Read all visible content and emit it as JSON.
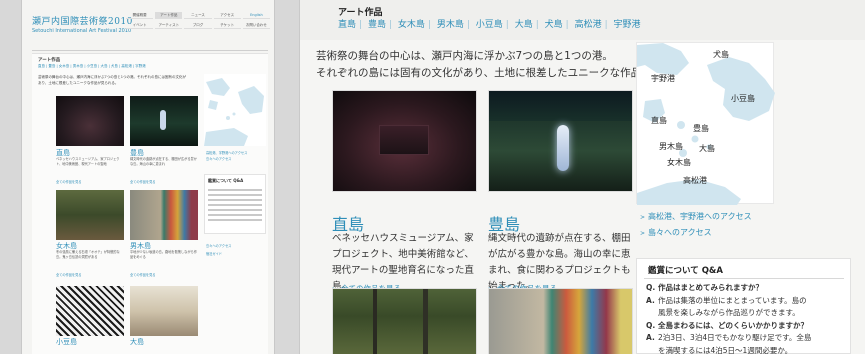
{
  "colors": {
    "accent": "#2e8eb8",
    "page_bg": "#d8d8d8",
    "panel_bg": "#f5f5f3",
    "map_sea": "#ffffff",
    "map_land": "#d0e5ef"
  },
  "thumbnail": {
    "logo_jp": "瀬戸内国際芸術祭2010",
    "logo_en": "Setouchi International Art Festival 2010",
    "nav": [
      {
        "label": "開催概要",
        "state": "normal"
      },
      {
        "label": "アート作品",
        "state": "active"
      },
      {
        "label": "ニュース",
        "state": "normal"
      },
      {
        "label": "アクセス",
        "state": "normal"
      },
      {
        "label": "English",
        "state": "link"
      },
      {
        "label": "イベント",
        "state": "normal"
      },
      {
        "label": "アーティスト",
        "state": "normal"
      },
      {
        "label": "ブログ",
        "state": "normal"
      },
      {
        "label": "チケット",
        "state": "normal"
      },
      {
        "label": "お問い合わせ",
        "state": "normal"
      }
    ],
    "section_title": "アート作品",
    "islands": "直島 | 豊島 | 女木島 | 男木島 | 小豆島 | 大島 | 犬島 | 高松港 | 宇野港",
    "intro": "芸術祭の舞台の中心は、瀬戸内海に浮かぶ7つの島と1つの港。それぞれの島には固有の文化があり、土地に根差したユニークな作品が見られる。",
    "works": [
      {
        "name": "直島",
        "desc": "ベネッセハウスミュージアム、家プロジェクト、地中美術館、現代アートの聖地",
        "more": "全ての作品を見る"
      },
      {
        "name": "豊島",
        "desc": "縄文時代の遺跡が点在する、棚田が広がる豊かな島。海山の幸に恵まれ",
        "more": "全ての作品を見る"
      },
      {
        "name": "女木島",
        "desc": "冬の強風に備える石垣「オオテ」が特徴的な島。鬼ヶ島伝説の洞窟がある",
        "more": "全ての作品を見る"
      },
      {
        "name": "男木島",
        "desc": "平地が少ない坂道の島。路地を散策しながら作品をめぐる",
        "more": "全ての作品を見る"
      },
      {
        "name": "小豆島",
        "desc": "",
        "more": ""
      },
      {
        "name": "大島",
        "desc": "",
        "more": ""
      }
    ],
    "map_links": [
      "高松港、宇野港へのアクセス",
      "島々へのアクセス"
    ],
    "qa_title": "鑑賞について Q&A",
    "side_links": [
      "島々へのアクセス",
      "宿泊ガイド"
    ]
  },
  "main": {
    "section_title": "アート作品",
    "islands": [
      "直島",
      "豊島",
      "女木島",
      "男木島",
      "小豆島",
      "大島",
      "犬島",
      "高松港",
      "宇野港"
    ],
    "intro_line1": "芸術祭の舞台の中心は、瀬戸内海に浮かぶ7つの島と1つの港。",
    "intro_line2": "それぞれの島には固有の文化があり、土地に根差したユニークな作品が見られる。",
    "works": [
      {
        "name": "直島",
        "desc": "ベネッセハウスミュージアム、家プロジェクト、地中美術館など、現代アートの聖地育名になった直島。",
        "more": "全ての作品を見る"
      },
      {
        "name": "豊島",
        "desc": "縄文時代の遺跡が点在する、棚田が広がる豊かな島。海山の幸に恵まれ、食に関わるプロジェクトも始まった。",
        "more": "全ての作品を見る"
      }
    ],
    "map_labels": [
      "犬島",
      "宇野港",
      "小豆島",
      "直島",
      "豊島",
      "男木島",
      "大島",
      "女木島",
      "高松港"
    ],
    "map_links": [
      "高松港、宇野港へのアクセス",
      "島々へのアクセス"
    ],
    "qa": {
      "title": "鑑賞について Q&A",
      "q1": "作品はまとめてみられますか？",
      "a1_line1": "作品は集落の単位にまとまっています。島の",
      "a1_line2": "風景を楽しみながら作品巡りができます。",
      "q2": "全島まわるには、どのくらいかかりますか？",
      "a2_line1": "2泊3日、3泊4日でもかなり駆け足です。全島",
      "a2_line2": "を満喫するには4泊5日〜1週間必要か。"
    }
  }
}
